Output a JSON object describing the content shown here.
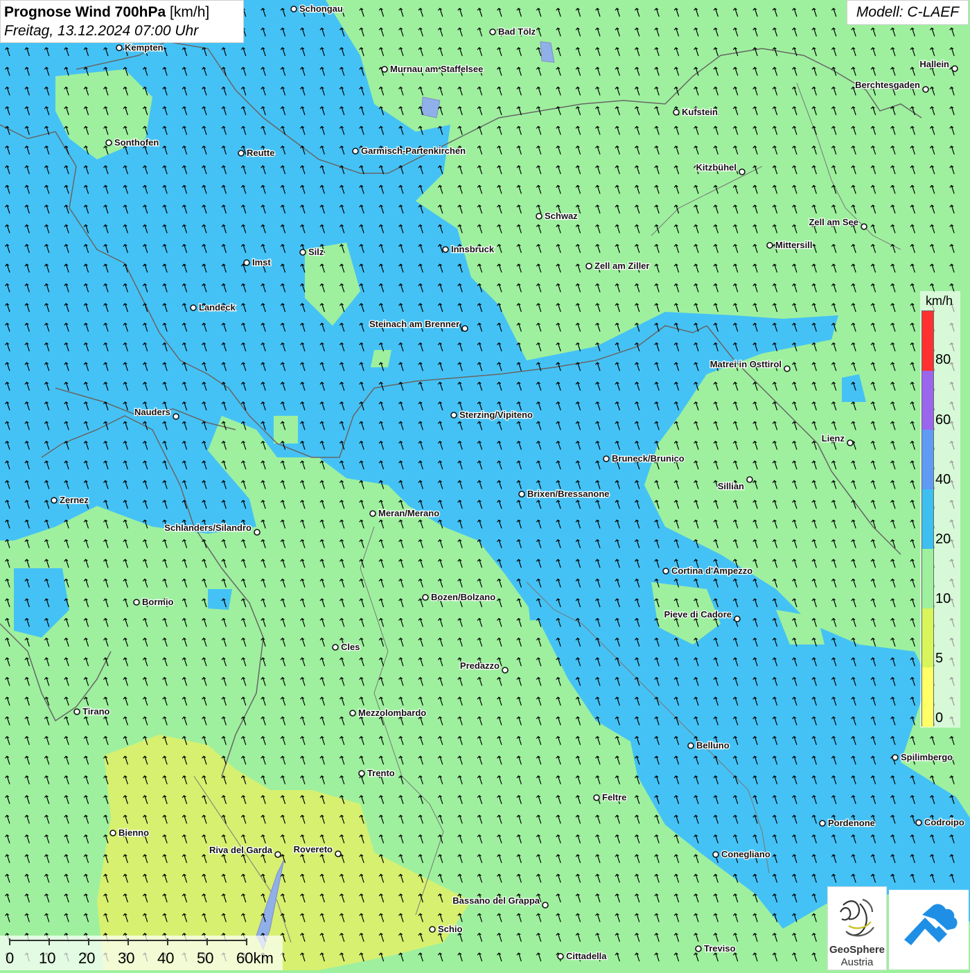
{
  "title": {
    "main": "Prognose Wind 700hPa",
    "unit": "[km/h]",
    "datetime": "Freitag, 13.12.2024 07:00 Uhr"
  },
  "model": "Modell: C-LAEF",
  "legend": {
    "unit": "km/h",
    "labels": [
      "80",
      "60",
      "40",
      "20",
      "10",
      "5",
      "0"
    ],
    "colors": [
      "#ff3030",
      "#9a66ee",
      "#5f9bf5",
      "#3dbfef",
      "#9ef09e",
      "#d8f55a",
      "#ffff66"
    ]
  },
  "scale_bar": {
    "labels": [
      "0",
      "10",
      "20",
      "30",
      "40",
      "50",
      "60km"
    ]
  },
  "logos": {
    "geosphere_line1": "GeoSphere",
    "geosphere_line2": "Austria"
  },
  "colors": {
    "wind_10_20": "#9ef09e",
    "wind_20_40": "#45c2f5",
    "wind_5_10": "#d7f070",
    "border": "#666666",
    "arrow": "#000000"
  },
  "cities": [
    {
      "name": "Schongau"
    },
    {
      "name": "Bad Tölz"
    },
    {
      "name": "Kempten"
    },
    {
      "name": "Murnau am Staffelsee"
    },
    {
      "name": "Hallein"
    },
    {
      "name": "Berchtesgaden"
    },
    {
      "name": "Kufstein"
    },
    {
      "name": "Sonthofen"
    },
    {
      "name": "Reutte"
    },
    {
      "name": "Garmisch-Partenkirchen"
    },
    {
      "name": "Kitzbühel"
    },
    {
      "name": "Schwaz"
    },
    {
      "name": "Zell am See"
    },
    {
      "name": "Mittersill"
    },
    {
      "name": "Silz"
    },
    {
      "name": "Innsbruck"
    },
    {
      "name": "Imst"
    },
    {
      "name": "Zell am Ziller"
    },
    {
      "name": "Landeck"
    },
    {
      "name": "Steinach am Brenner"
    },
    {
      "name": "Matrei in Osttirol"
    },
    {
      "name": "Nauders"
    },
    {
      "name": "Sterzing/Vipiteno"
    },
    {
      "name": "Lienz"
    },
    {
      "name": "Bruneck/Brunico"
    },
    {
      "name": "Sillian"
    },
    {
      "name": "Zernez"
    },
    {
      "name": "Brixen/Bressanone"
    },
    {
      "name": "Meran/Merano"
    },
    {
      "name": "Schlanders/Silandro"
    },
    {
      "name": "Cortina d'Ampezzo"
    },
    {
      "name": "Bormio"
    },
    {
      "name": "Bozen/Bolzano"
    },
    {
      "name": "Pieve di Cadore"
    },
    {
      "name": "Cles"
    },
    {
      "name": "Predazzo"
    },
    {
      "name": "Tirano"
    },
    {
      "name": "Mezzolombardo"
    },
    {
      "name": "Belluno"
    },
    {
      "name": "Spilimbergo"
    },
    {
      "name": "Trento"
    },
    {
      "name": "Feltre"
    },
    {
      "name": "Pordenone"
    },
    {
      "name": "Codroipo"
    },
    {
      "name": "Bienno"
    },
    {
      "name": "Riva del Garda"
    },
    {
      "name": "Rovereto"
    },
    {
      "name": "Conegliano"
    },
    {
      "name": "Bassano del Grappa"
    },
    {
      "name": "Schio"
    },
    {
      "name": "Treviso"
    },
    {
      "name": "Cittadella"
    }
  ]
}
